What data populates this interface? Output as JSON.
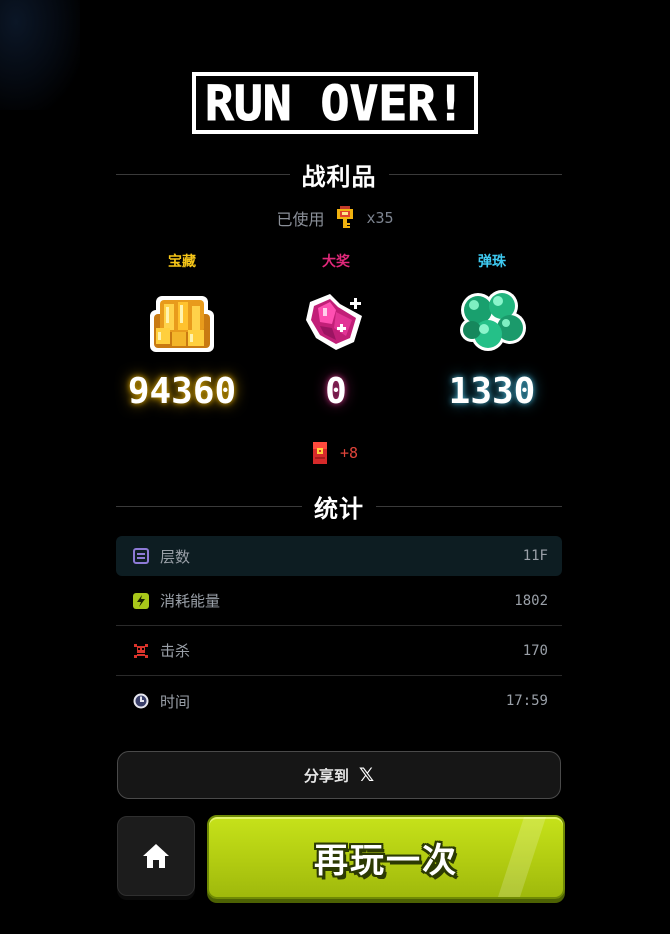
{
  "title": "RUN OVER!",
  "loot_section": {
    "heading": "战利品",
    "used_label": "已使用",
    "used_icon": "golden-key-icon",
    "used_count": "x35"
  },
  "loot": [
    {
      "name": "宝藏",
      "value": "94360",
      "icon": "gold-coins-icon",
      "color": "#f5c518"
    },
    {
      "name": "大奖",
      "value": "0",
      "icon": "pink-crystal-icon",
      "color": "#e0287a"
    },
    {
      "name": "弹珠",
      "value": "1330",
      "icon": "green-marbles-icon",
      "color": "#3ec9f0"
    }
  ],
  "bonus": {
    "icon": "red-envelope-icon",
    "text": "+8"
  },
  "stats_section": {
    "heading": "统计",
    "rows": [
      {
        "label": "层数",
        "value": "11F",
        "icon": "floors-icon"
      },
      {
        "label": "消耗能量",
        "value": "1802",
        "icon": "energy-icon"
      },
      {
        "label": "击杀",
        "value": "170",
        "icon": "kills-icon"
      },
      {
        "label": "时间",
        "value": "17:59",
        "icon": "clock-icon"
      }
    ]
  },
  "share": {
    "label": "分享到",
    "icon": "x-logo-icon"
  },
  "home": {
    "icon": "home-icon"
  },
  "replay": {
    "label": "再玩一次"
  },
  "colors": {
    "accent_green": "#b2cc11",
    "background": "#000000",
    "treasure": "#f5c518",
    "jackpot": "#e0287a",
    "marbles": "#3ec9f0",
    "bonus": "#e0443a"
  }
}
